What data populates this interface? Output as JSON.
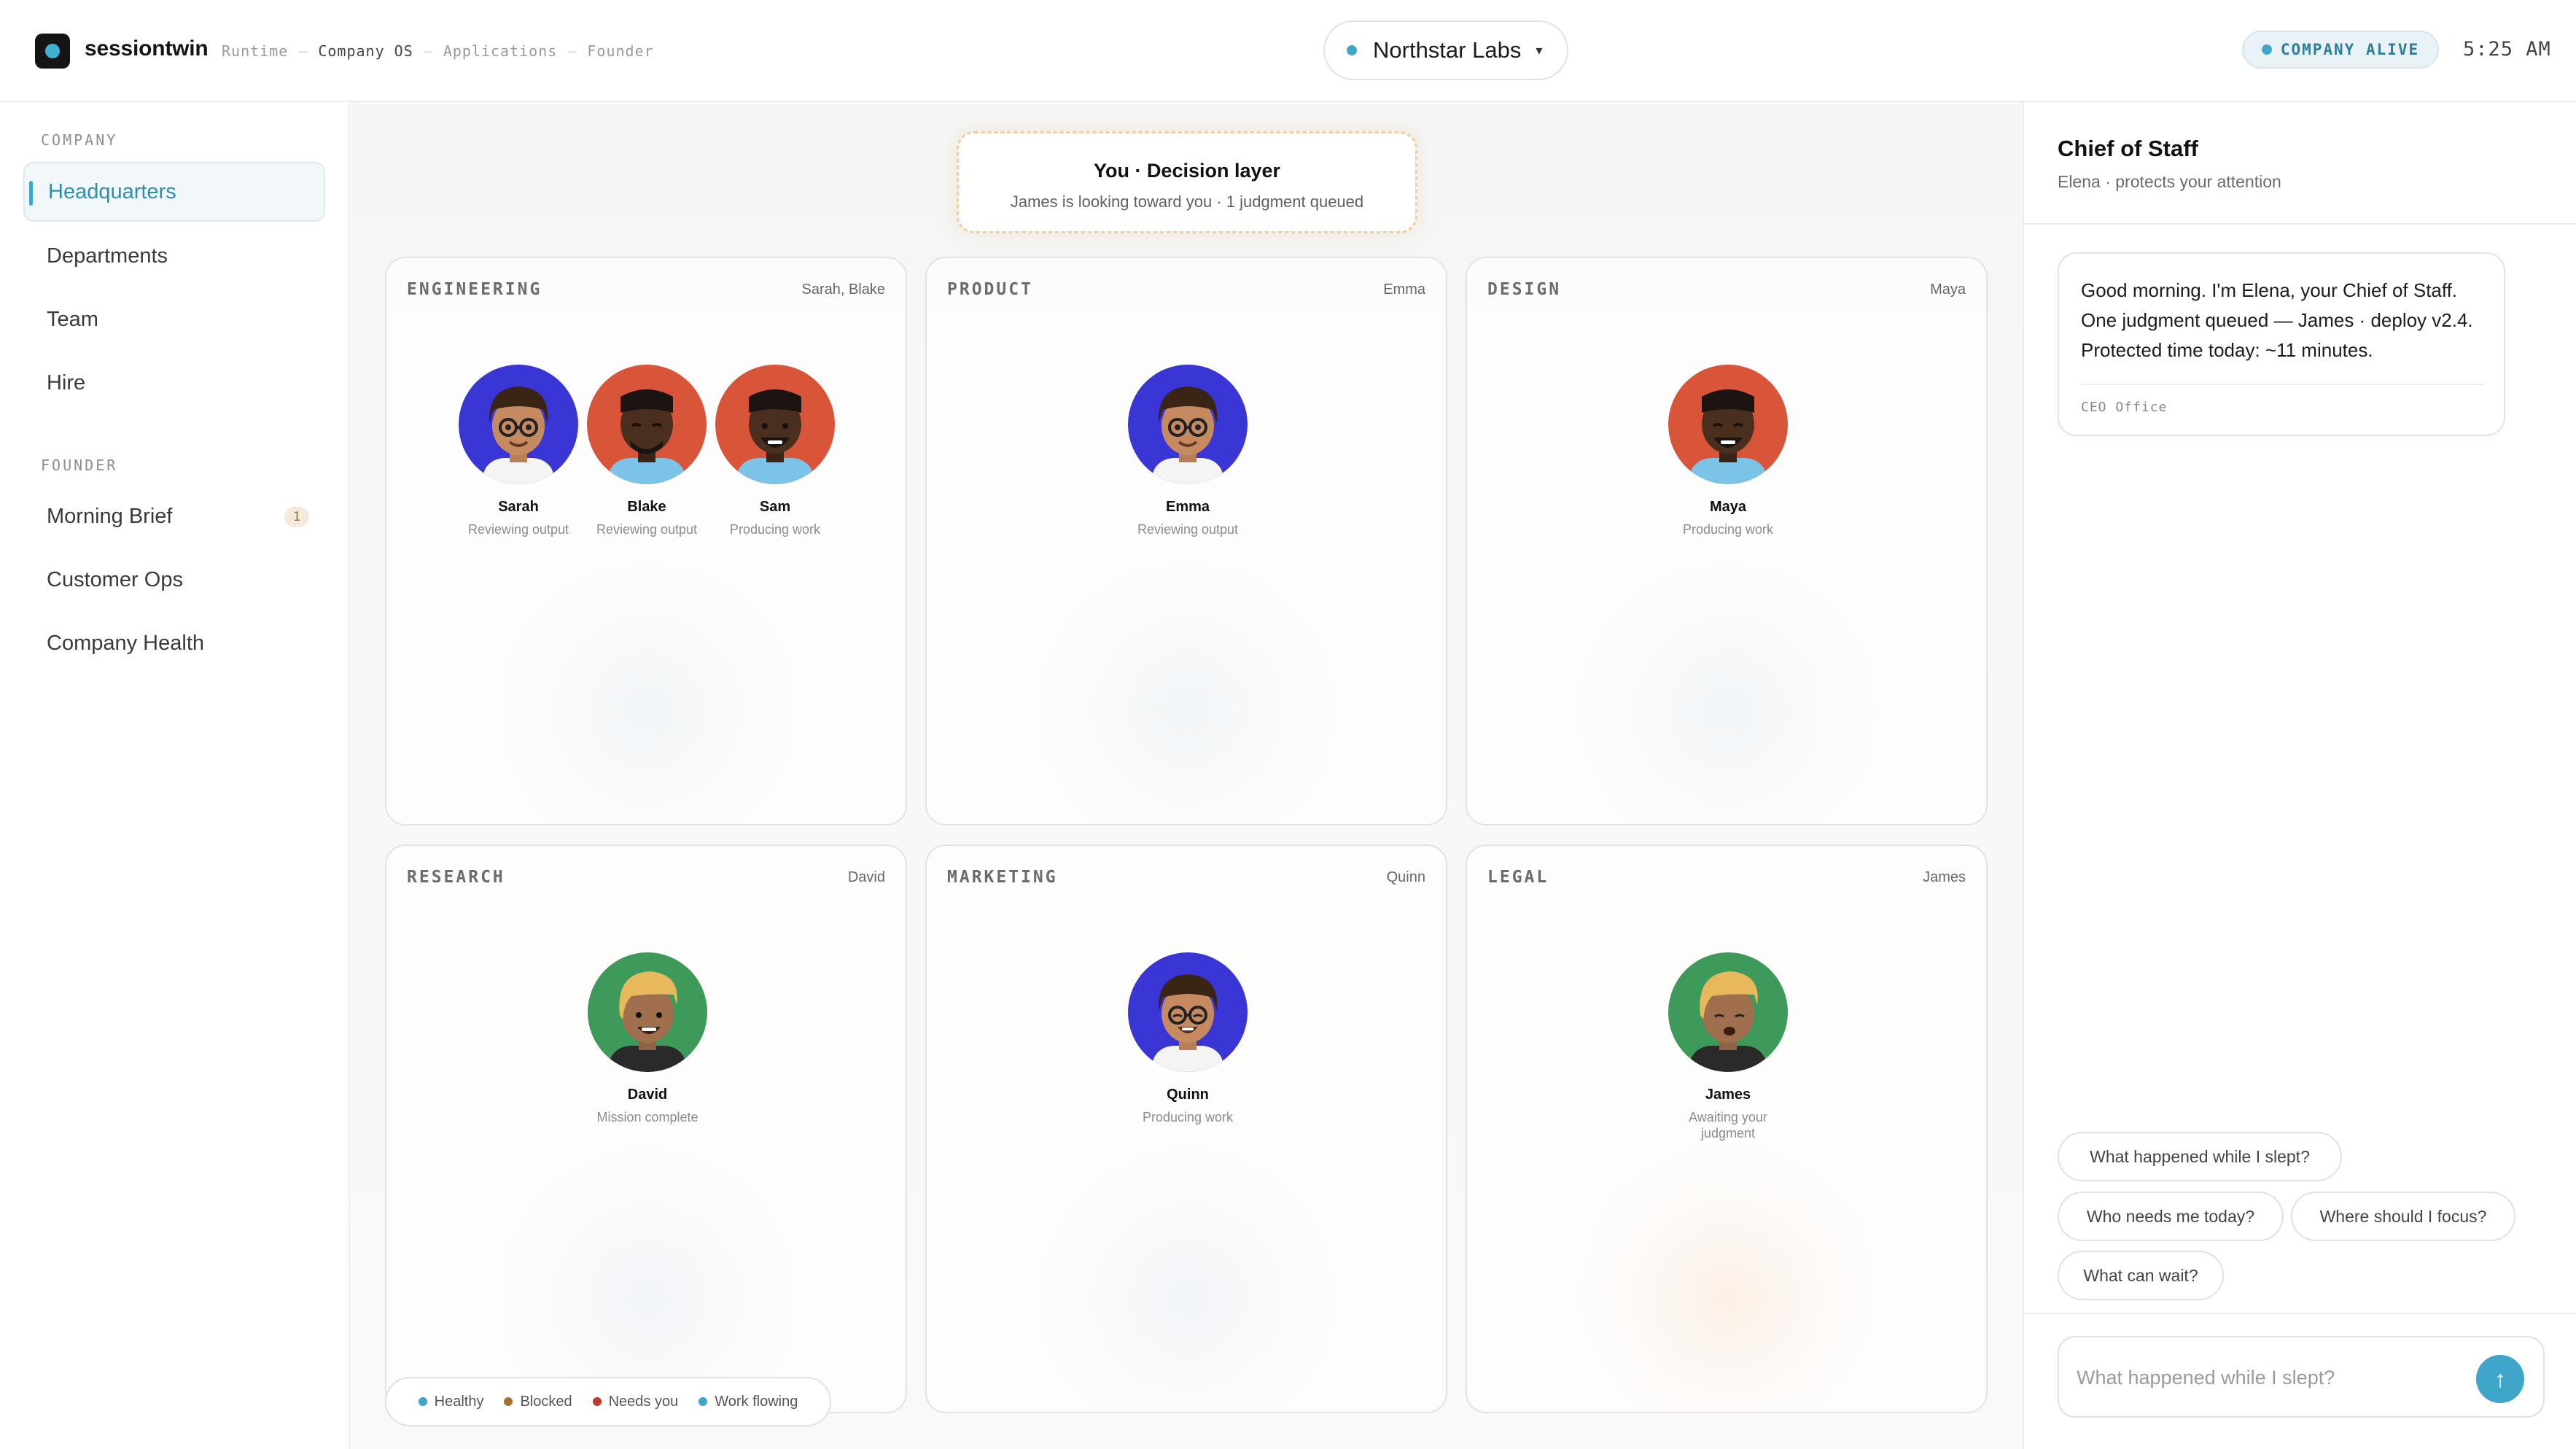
{
  "app": {
    "brand": "sessiontwin",
    "clock": "5:25 AM"
  },
  "breadcrumbs": [
    "Runtime",
    "Company OS",
    "Applications",
    "Founder"
  ],
  "org_selector": {
    "name": "Northstar Labs",
    "caret": "▾"
  },
  "status": {
    "label": "COMPANY ALIVE"
  },
  "sidebar": {
    "company_label": "COMPANY",
    "company_items": [
      "Headquarters",
      "Departments",
      "Team",
      "Hire"
    ],
    "founder_label": "FOUNDER",
    "founder_items": [
      "Morning Brief",
      "Customer Ops",
      "Company Health"
    ],
    "morning_brief_badge": "1"
  },
  "decision": {
    "title": "You · Decision layer",
    "subtitle": "James is looking toward you · 1 judgment queued"
  },
  "departments": [
    {
      "title": "ENGINEERING",
      "who": "Sarah, Blake",
      "members": [
        {
          "name": "Sarah",
          "status": "Reviewing output"
        },
        {
          "name": "Blake",
          "status": "Reviewing output"
        },
        {
          "name": "Sam",
          "status": "Producing work"
        }
      ]
    },
    {
      "title": "PRODUCT",
      "who": "Emma",
      "members": [
        {
          "name": "Emma",
          "status": "Reviewing output"
        }
      ]
    },
    {
      "title": "DESIGN",
      "who": "Maya",
      "members": [
        {
          "name": "Maya",
          "status": "Producing work"
        }
      ]
    },
    {
      "title": "RESEARCH",
      "who": "David",
      "members": [
        {
          "name": "David",
          "status": "Mission complete"
        }
      ]
    },
    {
      "title": "MARKETING",
      "who": "Quinn",
      "members": [
        {
          "name": "Quinn",
          "status": "Producing work"
        }
      ]
    },
    {
      "title": "LEGAL",
      "who": "James",
      "members": [
        {
          "name": "James",
          "status": "Awaiting your judgment"
        }
      ]
    }
  ],
  "legend": [
    "Healthy",
    "Blocked",
    "Needs you",
    "Work flowing"
  ],
  "colors": {
    "healthy": "#3fa6c9",
    "blocked": "#a2702a",
    "needs_you": "#c0392b",
    "work_flowing": "#3fa6c9",
    "accent": "#3fa6c9"
  },
  "chief": {
    "title": "Chief of Staff",
    "subtitle": "Elena · protects your attention",
    "message": "Good morning. I'm Elena, your Chief of Staff. One judgment queued — James · deploy v2.4. Protected time today: ~11 minutes.",
    "source": "CEO Office",
    "suggestions": [
      "What happened while I slept?",
      "Who needs me today?",
      "Where should I focus?",
      "What can wait?"
    ],
    "input_placeholder": "What happened while I slept?",
    "send_icon": "↑"
  }
}
